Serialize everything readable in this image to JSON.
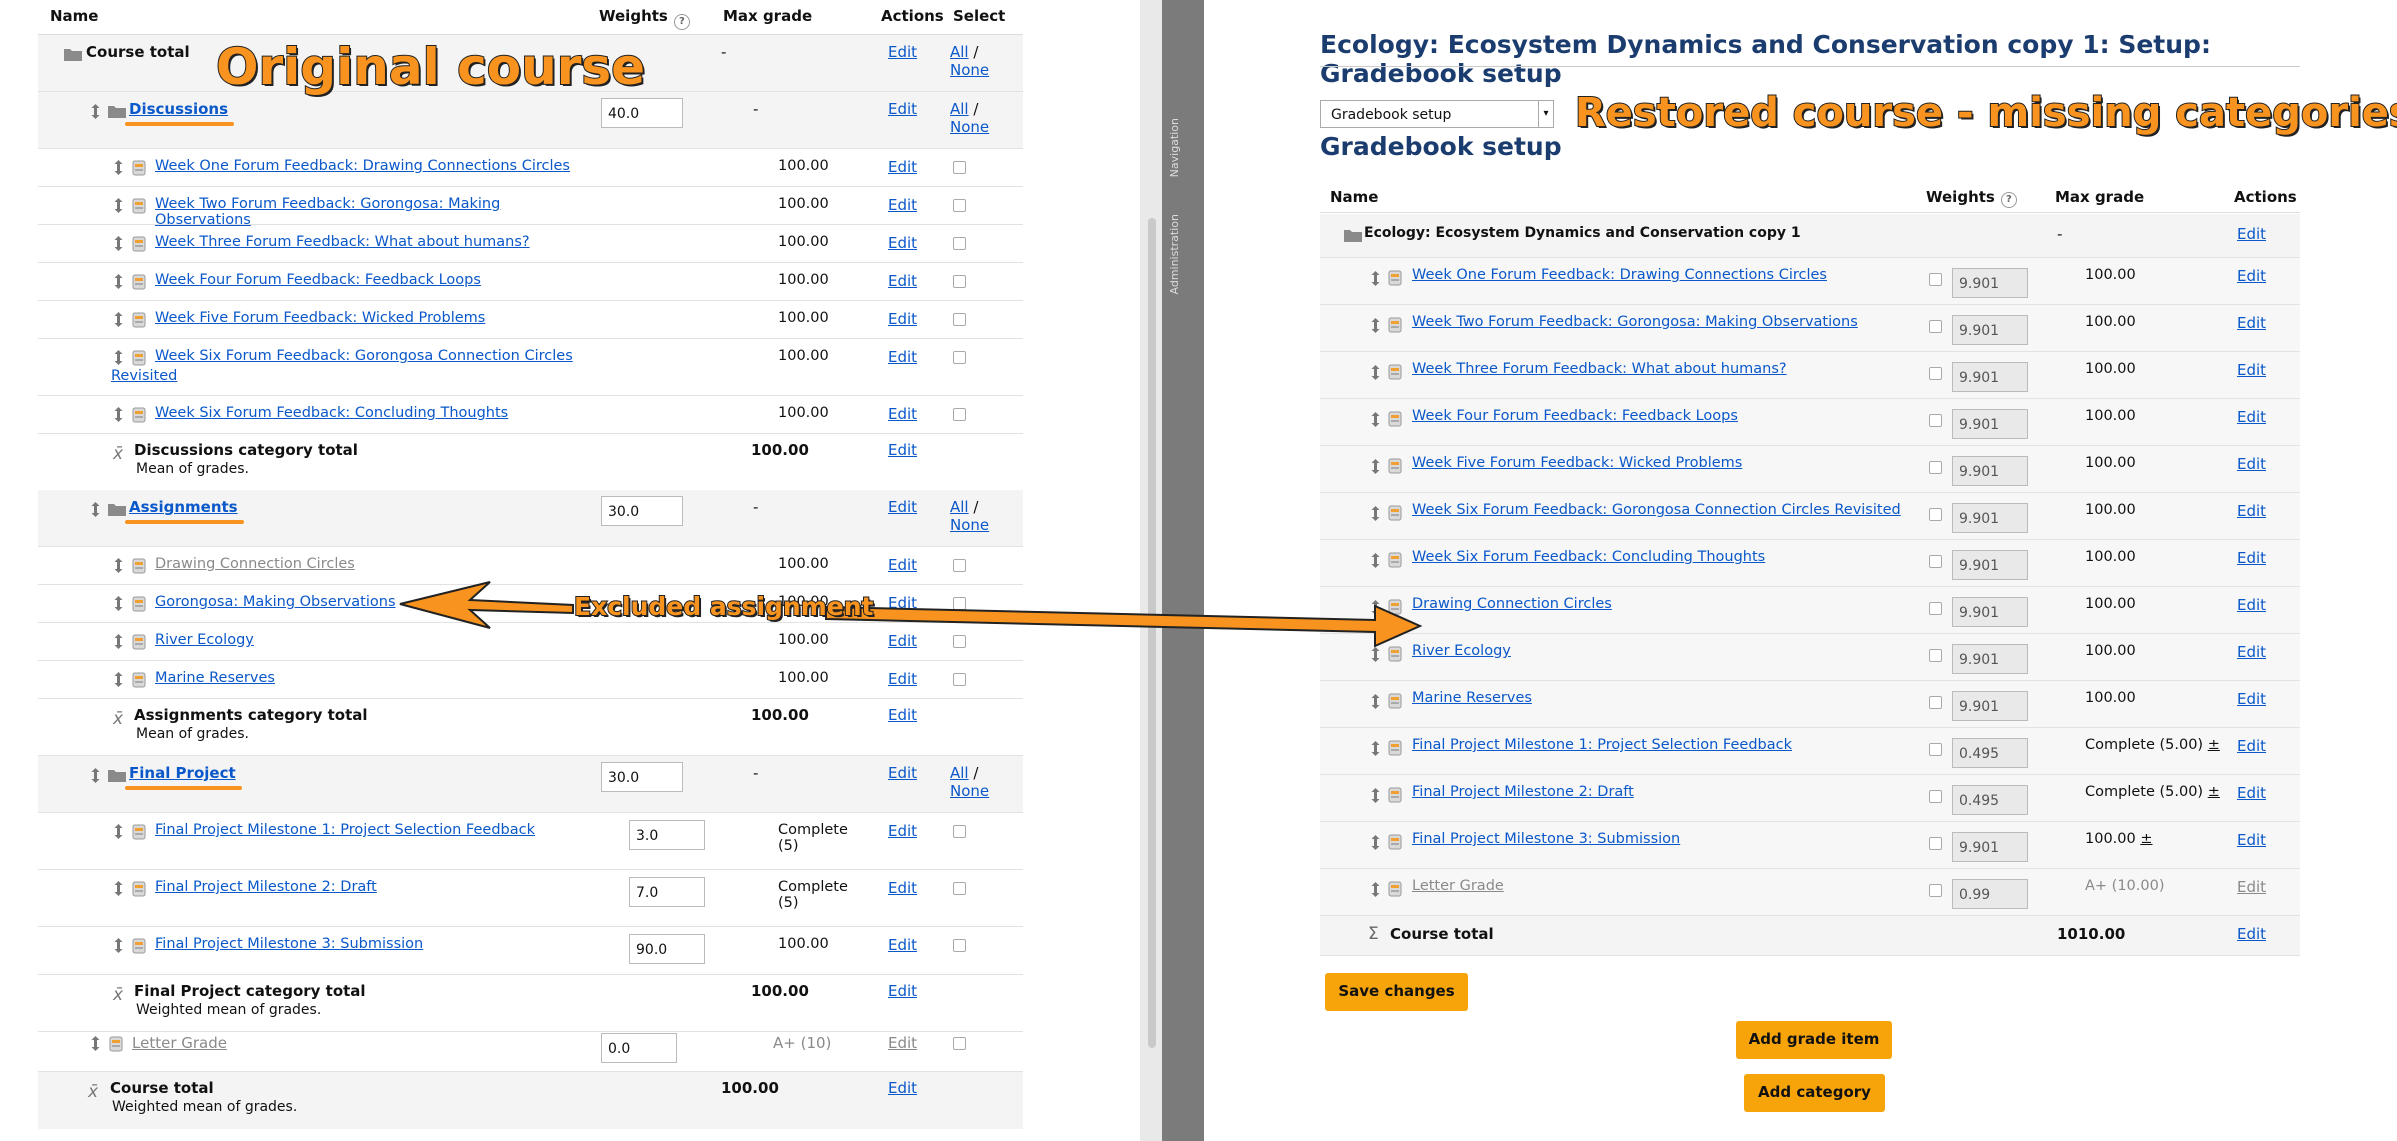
{
  "left": {
    "headers": {
      "name": "Name",
      "weights": "Weights",
      "max_grade": "Max grade",
      "actions": "Actions",
      "select": "Select"
    },
    "course_total": {
      "label": "Course total",
      "max": "-",
      "edit": "Edit",
      "all": "All",
      "sep": "/",
      "none": "None"
    },
    "categories": [
      {
        "name": "Discussions",
        "weight": "40.0",
        "max": "-",
        "edit": "Edit",
        "all": "All",
        "none": "None",
        "items": [
          {
            "name": "Week One Forum Feedback: Drawing Connections Circles",
            "max": "100.00",
            "edit": "Edit"
          },
          {
            "name": "Week Two Forum Feedback: Gorongosa: Making Observations",
            "max": "100.00",
            "edit": "Edit"
          },
          {
            "name": "Week Three Forum Feedback: What about humans?",
            "max": "100.00",
            "edit": "Edit"
          },
          {
            "name": "Week Four Forum Feedback: Feedback Loops",
            "max": "100.00",
            "edit": "Edit"
          },
          {
            "name": "Week Five Forum Feedback: Wicked Problems",
            "max": "100.00",
            "edit": "Edit"
          },
          {
            "name": "Week Six Forum Feedback: Gorongosa Connection Circles",
            "name2": "Revisited",
            "max": "100.00",
            "edit": "Edit"
          },
          {
            "name": "Week Six Forum Feedback: Concluding Thoughts",
            "max": "100.00",
            "edit": "Edit"
          }
        ],
        "total": {
          "label": "Discussions category total",
          "sub": "Mean of grades.",
          "max": "100.00",
          "edit": "Edit"
        }
      },
      {
        "name": "Assignments",
        "weight": "30.0",
        "max": "-",
        "edit": "Edit",
        "all": "All",
        "none": "None",
        "items": [
          {
            "name": "Drawing Connection Circles",
            "max": "100.00",
            "edit": "Edit"
          },
          {
            "name": "Gorongosa: Making Observations",
            "max": "100.00",
            "edit": "Edit"
          },
          {
            "name": "River Ecology",
            "max": "100.00",
            "edit": "Edit"
          },
          {
            "name": "Marine Reserves",
            "max": "100.00",
            "edit": "Edit"
          }
        ],
        "total": {
          "label": "Assignments category total",
          "sub": "Mean of grades.",
          "max": "100.00",
          "edit": "Edit"
        }
      },
      {
        "name": "Final Project",
        "weight": "30.0",
        "max": "-",
        "edit": "Edit",
        "all": "All",
        "none": "None",
        "items": [
          {
            "name": "Final Project Milestone 1: Project Selection Feedback",
            "weight": "3.0",
            "max": "Complete",
            "max2": "(5)",
            "edit": "Edit"
          },
          {
            "name": "Final Project Milestone 2: Draft",
            "weight": "7.0",
            "max": "Complete",
            "max2": "(5)",
            "edit": "Edit"
          },
          {
            "name": "Final Project Milestone 3: Submission",
            "weight": "90.0",
            "max": "100.00",
            "edit": "Edit"
          }
        ],
        "total": {
          "label": "Final Project category total",
          "sub": "Weighted mean of grades.",
          "max": "100.00",
          "edit": "Edit"
        }
      }
    ],
    "letter_grade": {
      "name": "Letter Grade",
      "weight": "0.0",
      "max": "A+ (10)",
      "edit": "Edit"
    },
    "bottom_total": {
      "label": "Course total",
      "sub": "Weighted mean of grades.",
      "max": "100.00",
      "edit": "Edit"
    }
  },
  "sidebar": {
    "navigation": "Navigation",
    "administration": "Administration"
  },
  "right": {
    "title": "Ecology: Ecosystem Dynamics and Conservation copy 1: Setup: Gradebook setup",
    "select_value": "Gradebook setup",
    "subtitle": "Gradebook setup",
    "headers": {
      "name": "Name",
      "weights": "Weights",
      "max_grade": "Max grade",
      "actions": "Actions"
    },
    "course": {
      "name": "Ecology: Ecosystem Dynamics and Conservation copy 1",
      "max": "-",
      "edit": "Edit"
    },
    "items": [
      {
        "name": "Week One Forum Feedback: Drawing Connections Circles",
        "weight": "9.901",
        "max": "100.00",
        "edit": "Edit"
      },
      {
        "name": "Week Two Forum Feedback: Gorongosa: Making Observations",
        "weight": "9.901",
        "max": "100.00",
        "edit": "Edit"
      },
      {
        "name": "Week Three Forum Feedback: What about humans?",
        "weight": "9.901",
        "max": "100.00",
        "edit": "Edit"
      },
      {
        "name": "Week Four Forum Feedback: Feedback Loops",
        "weight": "9.901",
        "max": "100.00",
        "edit": "Edit"
      },
      {
        "name": "Week Five Forum Feedback: Wicked Problems",
        "weight": "9.901",
        "max": "100.00",
        "edit": "Edit"
      },
      {
        "name": "Week Six Forum Feedback: Gorongosa Connection Circles Revisited",
        "weight": "9.901",
        "max": "100.00",
        "edit": "Edit"
      },
      {
        "name": "Week Six Forum Feedback: Concluding Thoughts",
        "weight": "9.901",
        "max": "100.00",
        "edit": "Edit"
      },
      {
        "name": "Drawing Connection Circles",
        "weight": "9.901",
        "max": "100.00",
        "edit": "Edit"
      },
      {
        "name": "River Ecology",
        "weight": "9.901",
        "max": "100.00",
        "edit": "Edit"
      },
      {
        "name": "Marine Reserves",
        "weight": "9.901",
        "max": "100.00",
        "edit": "Edit"
      },
      {
        "name": "Final Project Milestone 1: Project Selection Feedback",
        "weight": "0.495",
        "max": "Complete (5.00)",
        "pm": "±",
        "edit": "Edit"
      },
      {
        "name": "Final Project Milestone 2: Draft",
        "weight": "0.495",
        "max": "Complete (5.00)",
        "pm": "±",
        "edit": "Edit"
      },
      {
        "name": "Final Project Milestone 3: Submission",
        "weight": "9.901",
        "max": "100.00",
        "pm": "±",
        "edit": "Edit"
      },
      {
        "name": "Letter Grade",
        "weight": "0.99",
        "max": "A+ (10.00)",
        "edit": "Edit",
        "muted": true
      }
    ],
    "total": {
      "label": "Course total",
      "max": "1010.00",
      "edit": "Edit"
    },
    "buttons": {
      "save": "Save changes",
      "add_item": "Add grade item",
      "add_category": "Add category"
    }
  },
  "overlays": {
    "original": "Original course",
    "restored": "Restored course - missing categories",
    "excluded": "Excluded assignment"
  },
  "colors": {
    "accent_orange": "#f7931e",
    "button_orange": "#f7a40b",
    "link_blue": "#0a58ca",
    "heading_blue": "#1b3c6e"
  }
}
